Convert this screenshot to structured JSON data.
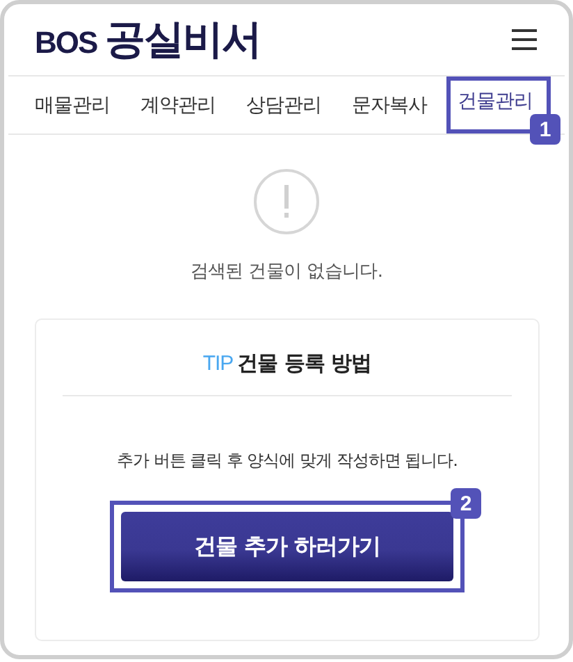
{
  "header": {
    "logo_prefix": "BOS",
    "logo_title": "공실비서"
  },
  "tabs": [
    {
      "label": "매물관리",
      "selected": false
    },
    {
      "label": "계약관리",
      "selected": false
    },
    {
      "label": "상담관리",
      "selected": false
    },
    {
      "label": "문자복사",
      "selected": false
    },
    {
      "label": "건물관리",
      "selected": true,
      "callout": "1"
    }
  ],
  "empty_state": {
    "message": "검색된 건물이 없습니다."
  },
  "tip_card": {
    "badge": "TIP",
    "title": "건물 등록 방법",
    "description": "추가 버튼 클릭 후 양식에 맞게 작성하면 됩니다.",
    "button": {
      "label": "건물 추가 하러가기",
      "callout": "2"
    }
  }
}
